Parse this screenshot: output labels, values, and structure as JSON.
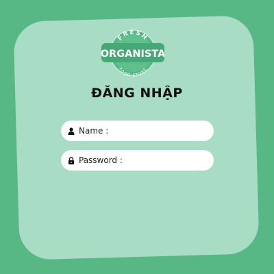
{
  "logo": {
    "top_text": "FRESH",
    "brand": "ORGANISTA",
    "bottom_text": "FOOD STORE",
    "colors": {
      "badge": "#57b785",
      "ribbon": "#46a874",
      "text": "#ffffff",
      "light": "#d7f2e3"
    }
  },
  "title": "ĐĂNG NHẬP",
  "fields": {
    "name": {
      "icon": "user-icon",
      "label": "Name :"
    },
    "password": {
      "icon": "lock-icon",
      "label": "Password :"
    }
  },
  "colors": {
    "background": "#57b785",
    "card": "#a8dcc5",
    "input": "#ffffff"
  }
}
